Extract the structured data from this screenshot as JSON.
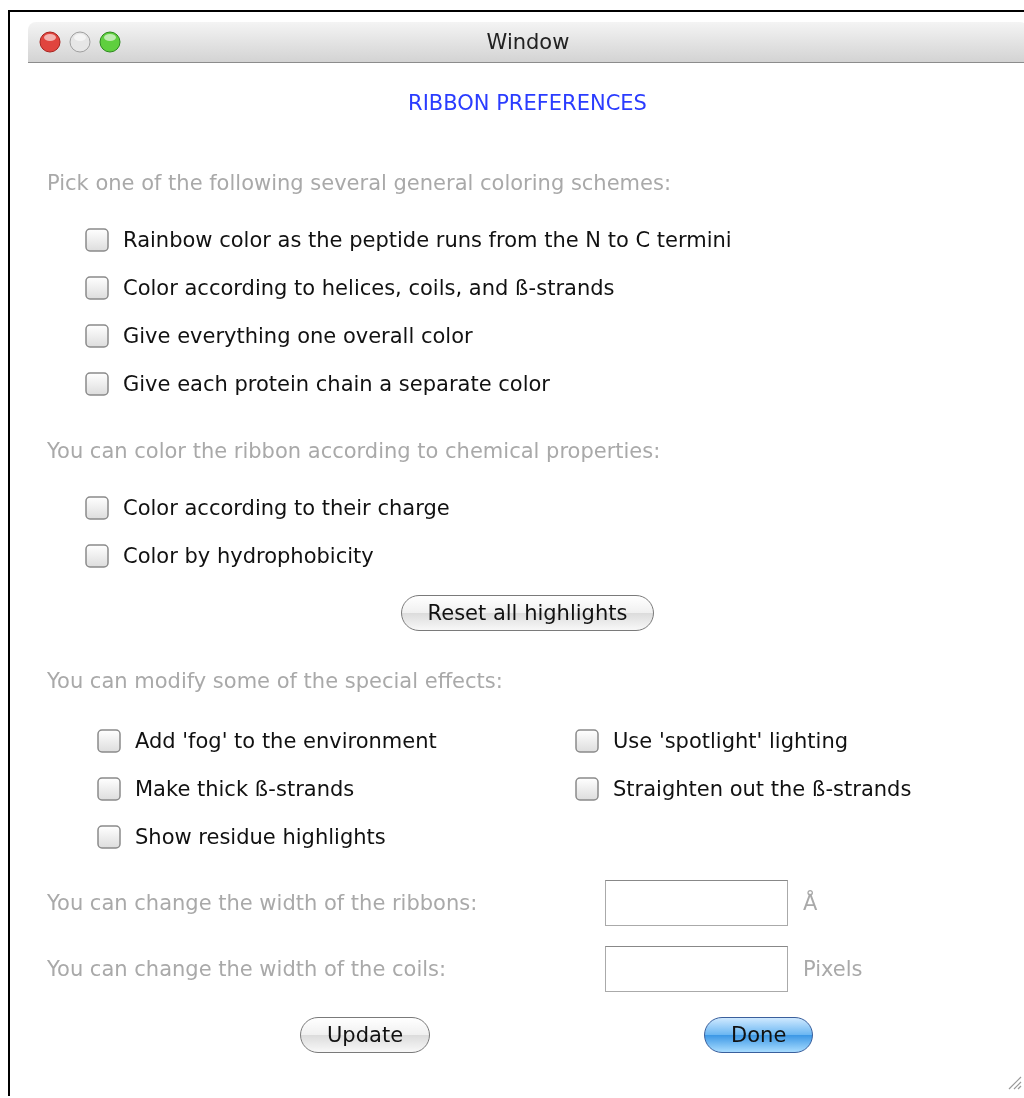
{
  "window": {
    "title": "Window"
  },
  "heading": "RIBBON PREFERENCES",
  "sections": [
    {
      "label": "Pick one of the following several general coloring schemes:",
      "options": [
        {
          "label": "Rainbow color as the peptide runs from the N to C termini",
          "checked": false
        },
        {
          "label": "Color according to helices, coils, and ß-strands",
          "checked": false
        },
        {
          "label": "Give everything one overall color",
          "checked": false
        },
        {
          "label": "Give each protein chain a separate color",
          "checked": false
        }
      ]
    },
    {
      "label": "You can color the ribbon according to chemical properties:",
      "options": [
        {
          "label": "Color according to their charge",
          "checked": false
        },
        {
          "label": "Color by hydrophobicity",
          "checked": false
        }
      ]
    }
  ],
  "reset_button": "Reset all highlights",
  "effects": {
    "label": "You can modify some of the special effects:",
    "options": [
      {
        "label": "Add 'fog' to the environment",
        "checked": false
      },
      {
        "label": "Use 'spotlight' lighting",
        "checked": false
      },
      {
        "label": "Make thick ß-strands",
        "checked": false
      },
      {
        "label": "Straighten out the ß-strands",
        "checked": false
      },
      {
        "label": "Show residue highlights",
        "checked": false
      }
    ]
  },
  "width_settings": [
    {
      "label": "You can change the width of the ribbons:",
      "unit": "Å"
    },
    {
      "label": "You can change the width of the coils:",
      "unit": "Pixels"
    }
  ],
  "buttons": [
    {
      "label": "Update",
      "kind": "plain"
    },
    {
      "label": "Done",
      "kind": "default"
    }
  ]
}
